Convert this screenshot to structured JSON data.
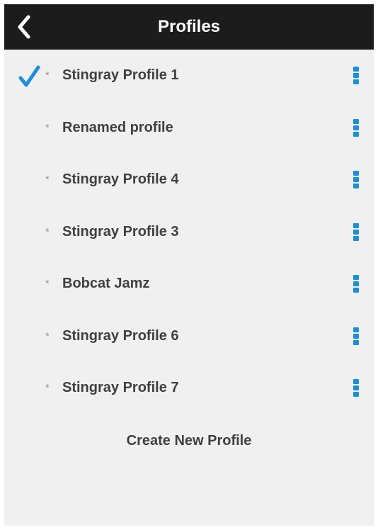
{
  "header": {
    "title": "Profiles",
    "back_icon": "chevron-left-icon",
    "background": "#1c1c1c"
  },
  "profiles": [
    {
      "name": "Stingray Profile 1",
      "selected": true
    },
    {
      "name": "Renamed profile",
      "selected": false
    },
    {
      "name": "Stingray Profile 4",
      "selected": false
    },
    {
      "name": "Stingray Profile 3",
      "selected": false
    },
    {
      "name": "Bobcat Jamz",
      "selected": false
    },
    {
      "name": "Stingray Profile 6",
      "selected": false
    },
    {
      "name": "Stingray Profile 7",
      "selected": false
    }
  ],
  "star_glyph": "*",
  "create_label": "Create New Profile",
  "colors": {
    "accent": "#1b8fdb",
    "background": "#f0f0f0",
    "text": "#404040"
  },
  "icons": {
    "selected": "checkmark-icon",
    "row_menu": "vertical-dots-icon"
  }
}
